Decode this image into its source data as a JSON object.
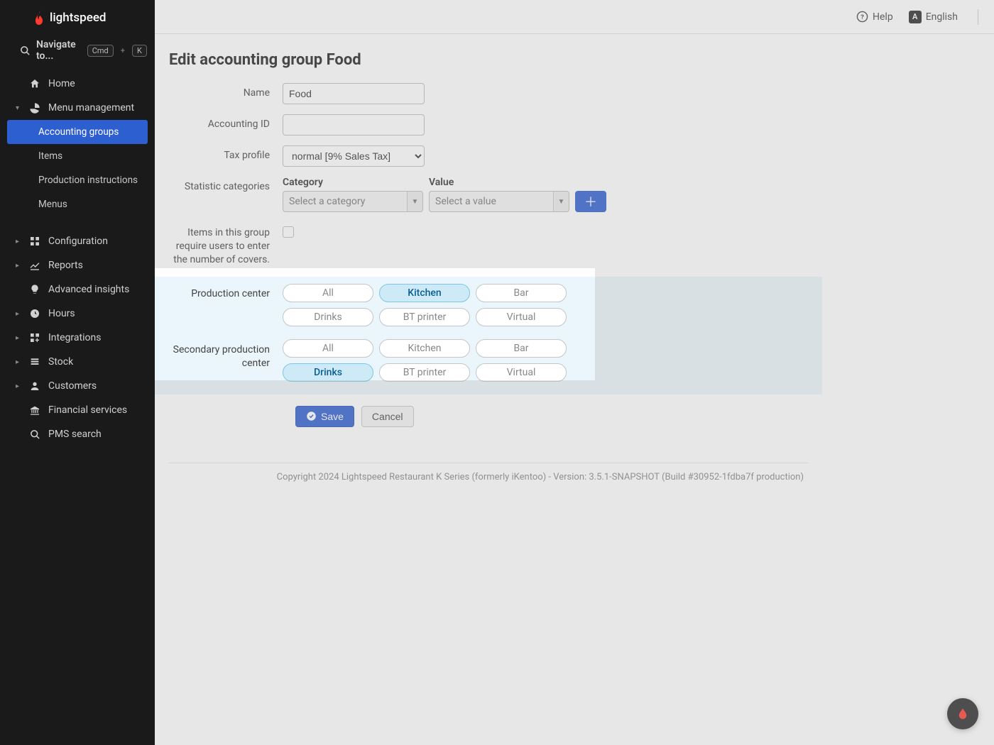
{
  "brand": {
    "name": "lightspeed"
  },
  "topbar": {
    "help": "Help",
    "language": "English",
    "lang_badge": "A"
  },
  "search": {
    "label": "Navigate to...",
    "kbd1": "Cmd",
    "kbd2": "K"
  },
  "sidebar": {
    "home": "Home",
    "menu_mgmt": "Menu management",
    "subitems": [
      "Accounting groups",
      "Items",
      "Production instructions",
      "Menus"
    ],
    "configuration": "Configuration",
    "reports": "Reports",
    "advanced_insights": "Advanced insights",
    "hours": "Hours",
    "integrations": "Integrations",
    "stock": "Stock",
    "customers": "Customers",
    "financial_services": "Financial services",
    "pms_search": "PMS search"
  },
  "page": {
    "title": "Edit accounting group Food",
    "labels": {
      "name": "Name",
      "accounting_id": "Accounting ID",
      "tax_profile": "Tax profile",
      "stat_categories": "Statistic categories",
      "covers": "Items in this group require users to enter the number of covers.",
      "prod_center": "Production center",
      "secondary_prod_center": "Secondary production center"
    },
    "values": {
      "name": "Food",
      "accounting_id": "",
      "tax_profile_selected": "normal [9% Sales Tax]",
      "covers_checked": false
    },
    "stat": {
      "head_category": "Category",
      "head_value": "Value",
      "category_placeholder": "Select a category",
      "value_placeholder": "Select a value"
    },
    "prod_center": {
      "options": [
        "All",
        "Kitchen",
        "Bar",
        "Drinks",
        "BT printer",
        "Virtual"
      ],
      "selected": "Kitchen"
    },
    "secondary_prod_center": {
      "options": [
        "All",
        "Kitchen",
        "Bar",
        "Drinks",
        "BT printer",
        "Virtual"
      ],
      "selected": "Drinks"
    },
    "actions": {
      "save": "Save",
      "cancel": "Cancel"
    },
    "footer": "Copyright 2024 Lightspeed Restaurant K Series (formerly iKentoo) - Version: 3.5.1-SNAPSHOT (Build #30952-1fdba7f production)"
  }
}
